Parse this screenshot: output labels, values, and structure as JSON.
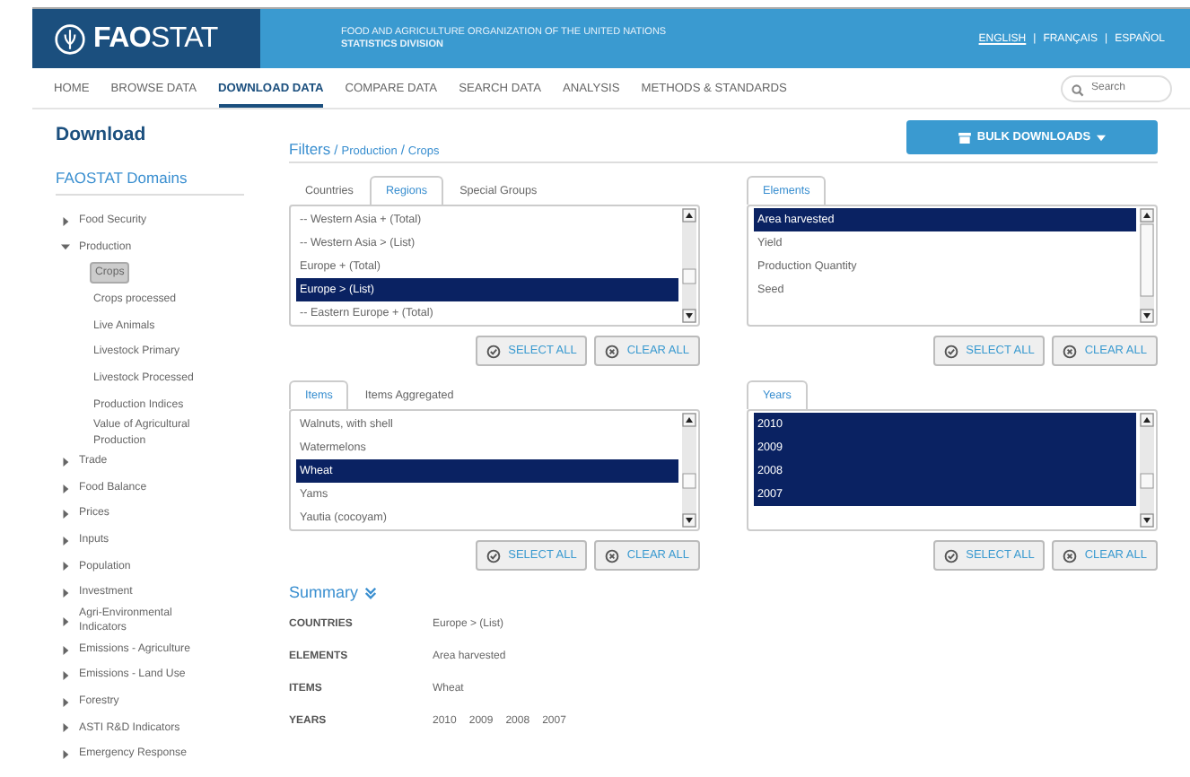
{
  "header": {
    "logo": "**FAO**STAT",
    "org_name": "FOOD AND AGRICULTURE ORGANIZATION OF THE UNITED NATIONS",
    "division": "STATISTICS DIVISION",
    "languages": [
      {
        "label": "ENGLISH",
        "selected": true
      },
      {
        "label": "FRANÇAIS",
        "selected": false
      },
      {
        "label": "ESPAÑOL",
        "selected": false
      }
    ],
    "language_separators": [
      "|",
      "|"
    ]
  },
  "nav": {
    "tabs": [
      {
        "label": "HOME",
        "selected": false
      },
      {
        "label": "BROWSE DATA",
        "selected": false
      },
      {
        "label": "DOWNLOAD DATA",
        "selected": true
      },
      {
        "label": "COMPARE DATA",
        "selected": false
      },
      {
        "label": "SEARCH DATA",
        "selected": false
      },
      {
        "label": "ANALYSIS",
        "selected": false
      },
      {
        "label": "METHODS & STANDARDS",
        "selected": false
      }
    ],
    "search": {
      "placeholder": "Search"
    }
  },
  "page_title": "Download",
  "sidebar": {
    "title": "FAOSTAT Domains",
    "items": [
      {
        "label": "Food Security",
        "expanded": false
      },
      {
        "label": "Production",
        "expanded": true,
        "children": [
          {
            "label": "Crops",
            "selected": true
          },
          {
            "label": "Crops processed",
            "selected": false
          },
          {
            "label": "Live Animals",
            "selected": false
          },
          {
            "label": "Livestock Primary",
            "selected": false
          },
          {
            "label": "Livestock Processed",
            "selected": false
          },
          {
            "label": "Production Indices",
            "selected": false
          },
          {
            "label": "Value of Agricultural Production",
            "selected": false
          }
        ]
      },
      {
        "label": "Trade",
        "expanded": false
      },
      {
        "label": "Food Balance",
        "expanded": false
      },
      {
        "label": "Prices",
        "expanded": false
      },
      {
        "label": "Inputs",
        "expanded": false
      },
      {
        "label": "Population",
        "expanded": false
      },
      {
        "label": "Investment",
        "expanded": false
      },
      {
        "label": "Agri-Environmental Indicators",
        "expanded": false
      },
      {
        "label": "Emissions - Agriculture",
        "expanded": false
      },
      {
        "label": "Emissions - Land Use",
        "expanded": false
      },
      {
        "label": "Forestry",
        "expanded": false
      },
      {
        "label": "ASTI R&D Indicators",
        "expanded": false
      },
      {
        "label": "Emergency Response",
        "expanded": false
      }
    ]
  },
  "filters": {
    "title": "Filters",
    "path": [
      "Production",
      "Crops"
    ],
    "separators": [
      "/",
      "/"
    ],
    "bulk_button": "BULK DOWNLOADS",
    "panels": [
      {
        "tabs": [
          {
            "label": "Countries",
            "selected": false
          },
          {
            "label": "Regions",
            "selected": true
          },
          {
            "label": "Special Groups",
            "selected": false
          }
        ],
        "options": [
          {
            "label": "-- Western Asia + (Total)",
            "selected": false
          },
          {
            "label": "-- Western Asia > (List)",
            "selected": false
          },
          {
            "label": "Europe + (Total)",
            "selected": false
          },
          {
            "label": "Europe > (List)",
            "selected": true
          },
          {
            "label": "-- Eastern Europe + (Total)",
            "selected": false
          }
        ],
        "buttons": [
          "SELECT ALL",
          "CLEAR ALL"
        ]
      },
      {
        "tabs": [
          {
            "label": "Elements",
            "selected": true
          }
        ],
        "options": [
          {
            "label": "Area harvested",
            "selected": true
          },
          {
            "label": "Yield",
            "selected": false
          },
          {
            "label": "Production Quantity",
            "selected": false
          },
          {
            "label": "Seed",
            "selected": false
          }
        ],
        "buttons": [
          "SELECT ALL",
          "CLEAR ALL"
        ]
      },
      {
        "tabs": [
          {
            "label": "Items",
            "selected": true
          },
          {
            "label": "Items Aggregated",
            "selected": false
          }
        ],
        "options": [
          {
            "label": "Walnuts, with shell",
            "selected": false
          },
          {
            "label": "Watermelons",
            "selected": false
          },
          {
            "label": "Wheat",
            "selected": true
          },
          {
            "label": "Yams",
            "selected": false
          },
          {
            "label": "Yautia (cocoyam)",
            "selected": false
          }
        ],
        "buttons": [
          "SELECT ALL",
          "CLEAR ALL"
        ]
      },
      {
        "tabs": [
          {
            "label": "Years",
            "selected": true
          }
        ],
        "options": [
          {
            "label": "2010",
            "selected": true
          },
          {
            "label": "2009",
            "selected": true
          },
          {
            "label": "2008",
            "selected": true
          },
          {
            "label": "2007",
            "selected": true
          }
        ],
        "buttons": [
          "SELECT ALL",
          "CLEAR ALL"
        ]
      }
    ]
  },
  "summary": {
    "title": "Summary",
    "rows": [
      {
        "label": "COUNTRIES",
        "values": [
          "Europe > (List)"
        ]
      },
      {
        "label": "ELEMENTS",
        "values": [
          "Area harvested"
        ]
      },
      {
        "label": "ITEMS",
        "values": [
          "Wheat"
        ]
      },
      {
        "label": "YEARS",
        "values": [
          "2010",
          "2009",
          "2008",
          "2007"
        ]
      }
    ]
  }
}
